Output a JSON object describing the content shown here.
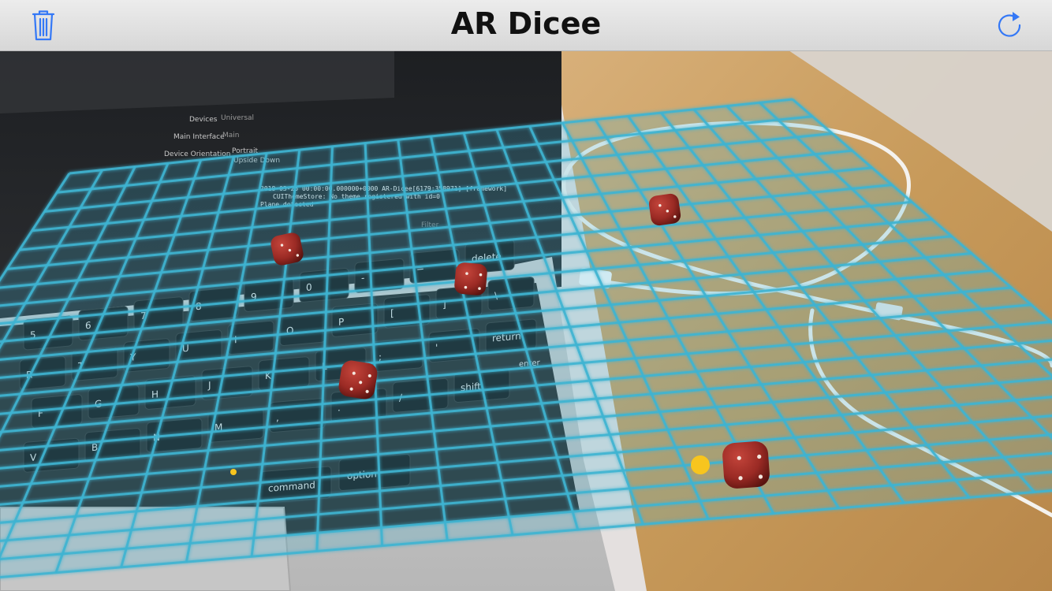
{
  "navbar": {
    "title": "AR Dicee",
    "left_icon": "trash-icon",
    "right_icon": "refresh-icon",
    "tint": "#3478f6"
  },
  "debug_console": {
    "line1": "2018-03-25 00:00:00.000000+0000 AR-Dicee[6179:358971] [framework]",
    "line2": "CUIThemeStore: No theme registered with id=0",
    "line3": "Plane detected"
  },
  "xcode_panel": {
    "devices_label": "Devices",
    "devices_value": "Universal",
    "main_interface_label": "Main Interface",
    "main_interface_value": "Main",
    "orientation_label": "Device Orientation",
    "orientation_portrait": "Portrait",
    "orientation_upside": "Upside Down",
    "filter_label": "Filter"
  },
  "keyboard": {
    "keys_row1": [
      "5",
      "6",
      "7",
      "8",
      "9",
      "0",
      "-",
      "=",
      "delete"
    ],
    "keys_row2": [
      "R",
      "T",
      "Y",
      "U",
      "I",
      "O",
      "P",
      "[",
      "]",
      "\\"
    ],
    "keys_row3": [
      "F",
      "G",
      "H",
      "J",
      "K",
      "L",
      ";",
      "'",
      "return"
    ],
    "keys_row4": [
      "V",
      "B",
      "N",
      "M",
      ",",
      ".",
      "/",
      "shift"
    ],
    "keys_row5": [
      "command",
      "option"
    ],
    "enter_label": "enter"
  },
  "dice": [
    {
      "name": "die-1",
      "face": "three"
    },
    {
      "name": "die-2",
      "face": "four"
    },
    {
      "name": "die-3",
      "face": "three"
    },
    {
      "name": "die-4",
      "face": "five"
    },
    {
      "name": "die-5",
      "face": "four"
    }
  ],
  "colors": {
    "grid": "#3fb4d2",
    "die": "#9a2a24",
    "feature_point": "#f7c51e",
    "desk": "#c79a5a"
  }
}
